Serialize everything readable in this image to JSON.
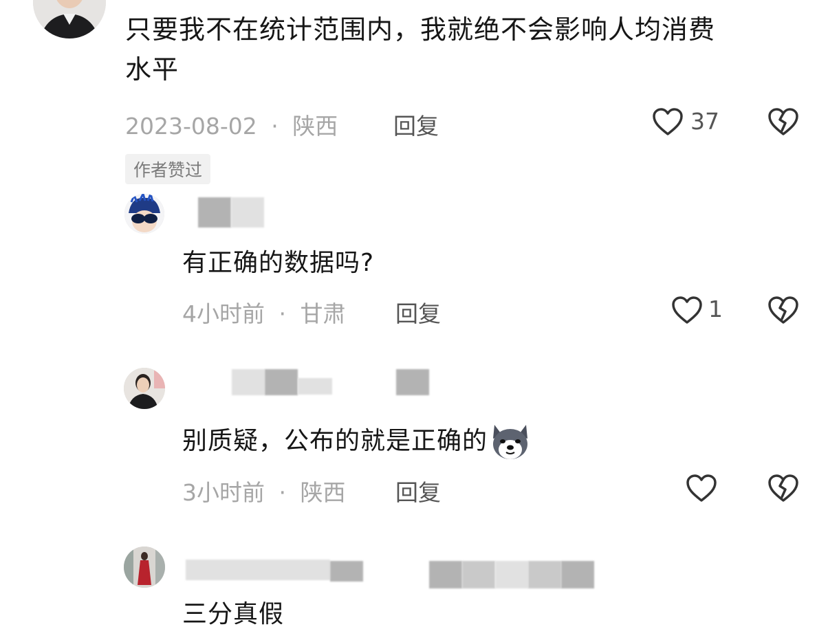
{
  "comments": [
    {
      "text": "只要我不在统计范围内，我就绝不会影响人均消费水平",
      "text_line1": "只要我不在统计范围内，我就绝不会影响人均消费",
      "text_line2": "水平",
      "date": "2023-08-02",
      "location": "陕西",
      "reply_label": "回复",
      "likes": "37",
      "badge": "作者赞过",
      "replies": [
        {
          "text": "有正确的数据吗?",
          "time": "4小时前",
          "location": "甘肃",
          "reply_label": "回复",
          "likes": "1"
        },
        {
          "text": "别质疑，公布的就是正确的",
          "emoji": "dog-emoji",
          "time": "3小时前",
          "location": "陕西",
          "reply_label": "回复",
          "likes": ""
        },
        {
          "text": "三分真假",
          "time": "",
          "location": "",
          "reply_label": "",
          "likes": ""
        }
      ]
    }
  ],
  "separator": "·",
  "icons": {
    "like": "heart-outline-icon",
    "dislike": "broken-heart-icon"
  },
  "colors": {
    "text": "#161616",
    "meta": "#a6a6a6",
    "badge_bg": "#f1f1f1"
  }
}
